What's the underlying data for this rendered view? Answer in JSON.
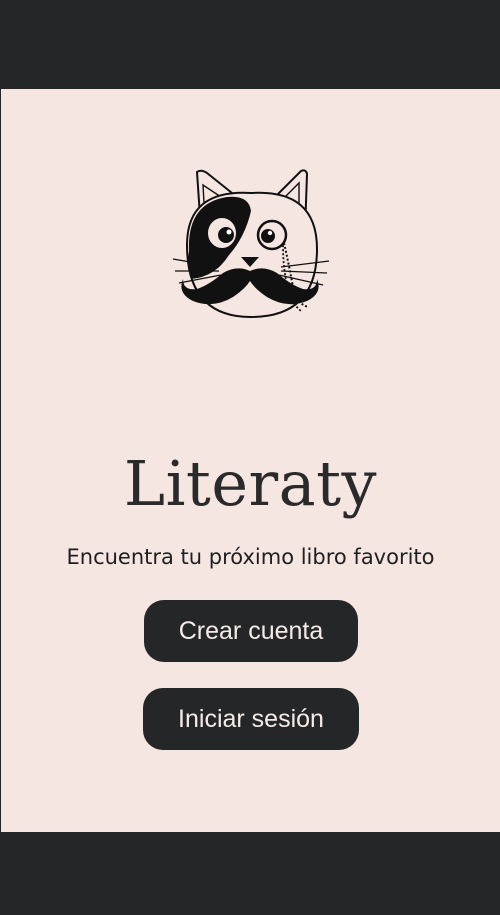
{
  "app": {
    "title": "Literaty",
    "subtitle": "Encuentra tu próximo libro favorito"
  },
  "actions": {
    "register_label": "Crear cuenta",
    "login_label": "Iniciar sesión"
  },
  "logo": {
    "icon": "cat-monocle-mustache-icon"
  },
  "colors": {
    "background": "#f5e6e2",
    "frame": "#252628",
    "text": "#2a2a2b",
    "button_text": "#f5ece9"
  }
}
